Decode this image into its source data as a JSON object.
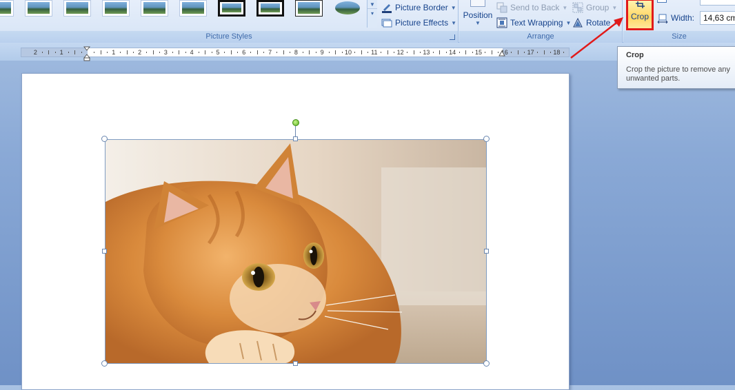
{
  "ribbon": {
    "picture_styles": {
      "label": "Picture Styles",
      "picture_border": "Picture Border",
      "picture_effects": "Picture Effects"
    },
    "arrange": {
      "label": "Arrange",
      "position": "Position",
      "send_to_back": "Send to Back",
      "text_wrapping": "Text Wrapping",
      "group": "Group",
      "rotate": "Rotate"
    },
    "size": {
      "label": "Size",
      "crop": "Crop",
      "width_label": "Width:",
      "width_value": "14,63 cm"
    }
  },
  "ruler": {
    "numbers": [
      "2",
      "1",
      "1",
      "2",
      "3",
      "4",
      "5",
      "6",
      "7",
      "8",
      "9",
      "10",
      "11",
      "12",
      "13",
      "14",
      "15",
      "16",
      "17",
      "18"
    ]
  },
  "tooltip": {
    "title": "Crop",
    "body": "Crop the picture to remove any unwanted parts."
  },
  "colors": {
    "highlight_border": "#e11a1a",
    "annotation_arrow": "#e11a1a",
    "rotation_handle": "#5ab31f"
  },
  "icons": [
    "picture-border-icon",
    "picture-effects-icon",
    "position-icon",
    "send-to-back-icon",
    "text-wrapping-icon",
    "group-icon",
    "rotate-icon",
    "crop-icon",
    "width-icon"
  ]
}
